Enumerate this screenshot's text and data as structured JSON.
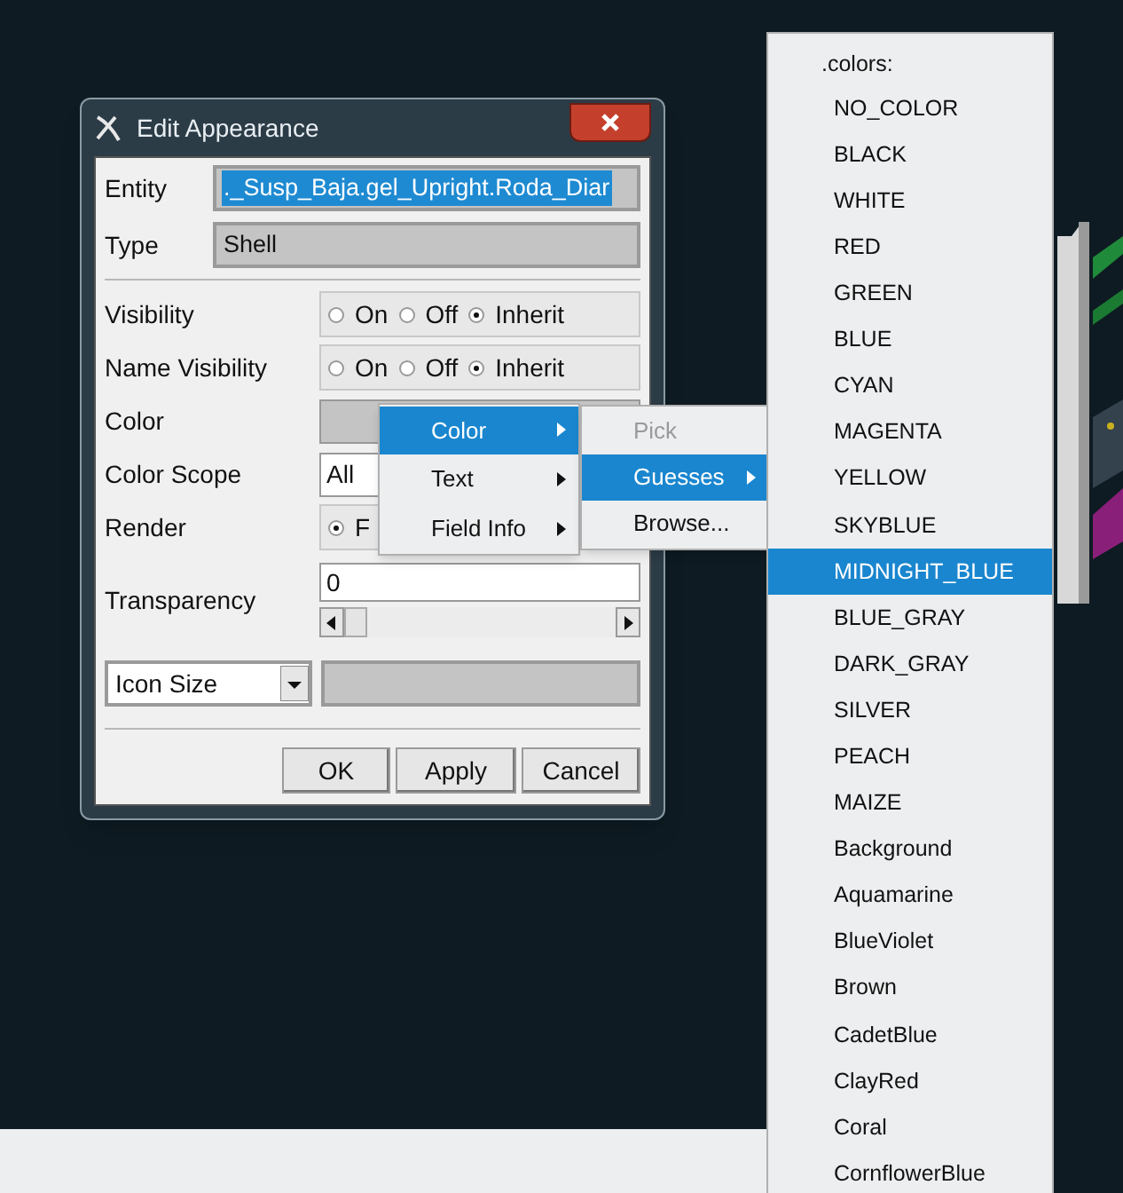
{
  "dialog": {
    "title": "Edit Appearance",
    "rows": [
      {
        "kind": "text",
        "label": "Entity",
        "value": "._Susp_Baja.gel_Upright.Roda_Diar",
        "highlighted": true
      },
      {
        "kind": "text",
        "label": "Type",
        "value": "Shell",
        "highlighted": false
      },
      {
        "kind": "radio",
        "label": "Visibility",
        "choices": [
          {
            "label": "On",
            "selected": false
          },
          {
            "label": "Off",
            "selected": false
          },
          {
            "label": "Inherit",
            "selected": true
          }
        ]
      },
      {
        "kind": "radio",
        "label": "Name Visibility",
        "choices": [
          {
            "label": "On",
            "selected": false
          },
          {
            "label": "Off",
            "selected": false
          },
          {
            "label": "Inherit",
            "selected": true
          }
        ]
      },
      {
        "kind": "swatch",
        "label": "Color"
      },
      {
        "kind": "dropdown",
        "label": "Color Scope",
        "value": "All"
      },
      {
        "kind": "radio",
        "label": "Render",
        "choices": [
          {
            "label": "F",
            "selected": true
          }
        ]
      },
      {
        "kind": "slider",
        "label": "Transparency",
        "value": "0"
      }
    ],
    "icon_size": "Icon Size",
    "buttons": [
      "OK",
      "Apply",
      "Cancel"
    ]
  },
  "context_menu": {
    "items": [
      {
        "label": "Color",
        "selected": true
      },
      {
        "label": "Text",
        "selected": false
      },
      {
        "label": "Field Info",
        "selected": false
      }
    ]
  },
  "submenu": {
    "items": [
      {
        "label": "Pick",
        "selected": false,
        "disabled": true
      },
      {
        "label": "Guesses",
        "selected": true,
        "disabled": false
      },
      {
        "label": "Browse...",
        "selected": false,
        "disabled": false
      }
    ]
  },
  "colors_menu": {
    "header": ".colors:",
    "items": [
      {
        "label": "NO_COLOR",
        "selected": false
      },
      {
        "label": "BLACK",
        "selected": false
      },
      {
        "label": "WHITE",
        "selected": false
      },
      {
        "label": "RED",
        "selected": false
      },
      {
        "label": "GREEN",
        "selected": false
      },
      {
        "label": "BLUE",
        "selected": false
      },
      {
        "label": "CYAN",
        "selected": false
      },
      {
        "label": "MAGENTA",
        "selected": false
      },
      {
        "label": "YELLOW",
        "selected": false
      },
      {
        "label": "SKYBLUE",
        "selected": false
      },
      {
        "label": "MIDNIGHT_BLUE",
        "selected": true
      },
      {
        "label": "BLUE_GRAY",
        "selected": false
      },
      {
        "label": "DARK_GRAY",
        "selected": false
      },
      {
        "label": "SILVER",
        "selected": false
      },
      {
        "label": "PEACH",
        "selected": false
      },
      {
        "label": "MAIZE",
        "selected": false
      },
      {
        "label": "Background",
        "selected": false
      },
      {
        "label": "Aquamarine",
        "selected": false
      },
      {
        "label": "BlueViolet",
        "selected": false
      },
      {
        "label": "Brown",
        "selected": false
      },
      {
        "label": "CadetBlue",
        "selected": false
      },
      {
        "label": "ClayRed",
        "selected": false
      },
      {
        "label": "Coral",
        "selected": false
      },
      {
        "label": "CornflowerBlue",
        "selected": false
      }
    ]
  }
}
